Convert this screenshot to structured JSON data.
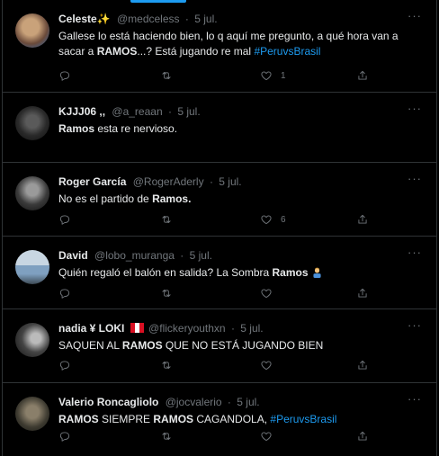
{
  "tweets": [
    {
      "name": "Celeste✨",
      "handle": "@medceless",
      "date": "5 jul.",
      "text_parts": [
        "Gallese lo está haciendo bien, lo q aquí me pregunto, a qué hora van a sacar a ",
        "RAMOS",
        "...? Está jugando re mal "
      ],
      "hashtag": "#PeruvsBrasil",
      "like_count": "1",
      "avatar_colors": [
        "#6a4a3a",
        "#c9a27a"
      ]
    },
    {
      "name": "KJJJ06 ,,",
      "handle": "@a_reaan",
      "date": "5 jul.",
      "text_parts": [
        "Ramos",
        " esta re nervioso."
      ],
      "avatar_colors": [
        "#1a1a1a",
        "#5a5a5a"
      ]
    },
    {
      "name": "Roger García",
      "handle": "@RogerAderly",
      "date": "5 jul.",
      "text_parts": [
        "No es el partido de ",
        "Ramos."
      ],
      "like_count": "6",
      "avatar_colors": [
        "#222",
        "#888"
      ]
    },
    {
      "name": "David",
      "handle": "@lobo_muranga",
      "date": "5 jul.",
      "text_parts": [
        "Quién regaló el balón en salida? La Sombra ",
        "Ramos"
      ],
      "avatar_colors": [
        "#7fa0c0",
        "#c8d6e2"
      ]
    },
    {
      "name": "nadia ¥ LOKI",
      "handle": "@flickeryouthxn",
      "date": "5 jul.",
      "text_parts": [
        "SAQUEN AL ",
        "RAMOS",
        " QUE NO ESTÁ JUGANDO BIEN"
      ],
      "avatar_colors": [
        "#333",
        "#bbb"
      ]
    },
    {
      "name": "Valerio Roncagliolo",
      "handle": "@jocvalerio",
      "date": "5 jul.",
      "text_parts": [
        "RAMOS",
        " SIEMPRE ",
        "RAMOS",
        " CAGANDOLA,  "
      ],
      "hashtag": "#PeruvsBrasil",
      "avatar_colors": [
        "#3d3a30",
        "#8a7f6a"
      ]
    }
  ],
  "colors": {
    "background": "#000000",
    "accent": "#1d9bf0",
    "muted": "#71767b",
    "text": "#e7e9ea",
    "divider": "#2f3336"
  },
  "icons": {
    "reply": "reply-icon",
    "retweet": "retweet-icon",
    "like": "heart-icon",
    "share": "share-icon",
    "more": "more-icon"
  }
}
